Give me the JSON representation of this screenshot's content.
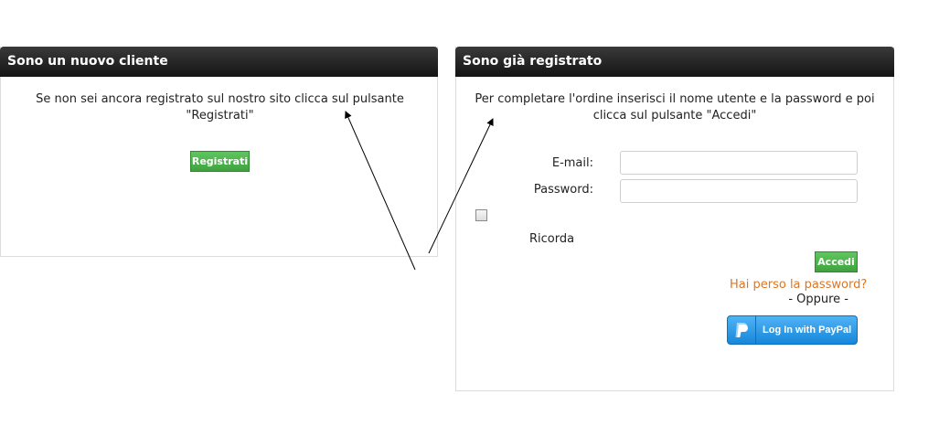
{
  "new_customer": {
    "title": "Sono un nuovo cliente",
    "text": "Se non sei ancora registrato sul nostro sito clicca sul pulsante \"Registrati\"",
    "register_label": "Registrati"
  },
  "registered": {
    "title": "Sono già registrato",
    "text": "Per completare l'ordine inserisci il nome utente e la password e poi clicca sul pulsante \"Accedi\"",
    "email_label": "E-mail:",
    "email_value": "",
    "password_label": "Password:",
    "password_value": "",
    "remember_label": "Ricorda",
    "login_label": "Accedi",
    "lost_password": "Hai perso la password?",
    "or_text": "- Oppure -",
    "paypal_label": "Log In with PayPal"
  },
  "icons": {
    "paypal": "paypal-icon",
    "arrows": "annotation-arrow"
  },
  "colors": {
    "header_bg": "#1c1c1c",
    "button_green": "#4cb34c",
    "link_orange": "#e0751f",
    "paypal_blue": "#1e8fe0"
  }
}
